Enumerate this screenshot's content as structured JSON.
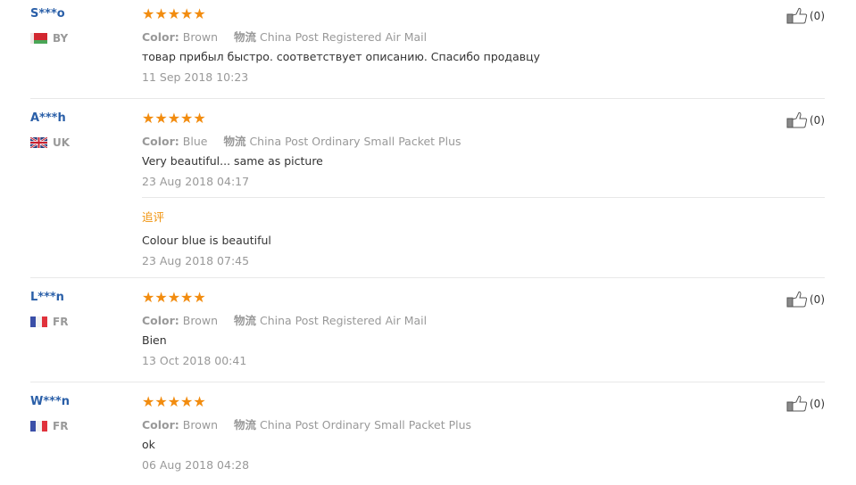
{
  "reviews": [
    {
      "user": "S***o",
      "country_code": "BY",
      "flag": "belarus",
      "color_label": "Color:",
      "color_value": "Brown",
      "shipping_label": "物流",
      "shipping_value": "China Post Registered Air Mail",
      "text": "товар прибыл быстро. соответствует описанию. Спасибо продавцу",
      "date": "11 Sep 2018 10:23",
      "rating": 5,
      "stars": "★★★★★",
      "likes": "(0)"
    },
    {
      "user": "A***h",
      "country_code": "UK",
      "flag": "united-kingdom",
      "color_label": "Color:",
      "color_value": "Blue",
      "shipping_label": "物流",
      "shipping_value": "China Post Ordinary Small Packet Plus",
      "text": "Very beautiful... same as picture",
      "date": "23 Aug 2018 04:17",
      "rating": 5,
      "stars": "★★★★★",
      "likes": "(0)",
      "additional": {
        "title": "追评",
        "text": "Colour blue is beautiful",
        "date": "23 Aug 2018 07:45"
      }
    },
    {
      "user": "L***n",
      "country_code": "FR",
      "flag": "france",
      "color_label": "Color:",
      "color_value": "Brown",
      "shipping_label": "物流",
      "shipping_value": "China Post Registered Air Mail",
      "text": "Bien",
      "date": "13 Oct 2018 00:41",
      "rating": 5,
      "stars": "★★★★★",
      "likes": "(0)"
    },
    {
      "user": "W***n",
      "country_code": "FR",
      "flag": "france",
      "color_label": "Color:",
      "color_value": "Brown",
      "shipping_label": "物流",
      "shipping_value": "China Post Ordinary Small Packet Plus",
      "text": "ok",
      "date": "06 Aug 2018 04:28",
      "rating": 5,
      "stars": "★★★★★",
      "likes": "(0)"
    }
  ],
  "colors": {
    "username": "#2a5fa8",
    "star": "#f28c0f",
    "muted": "#999999",
    "append_title": "#f0930c"
  },
  "icons": {
    "like": "thumbs-up-icon"
  }
}
